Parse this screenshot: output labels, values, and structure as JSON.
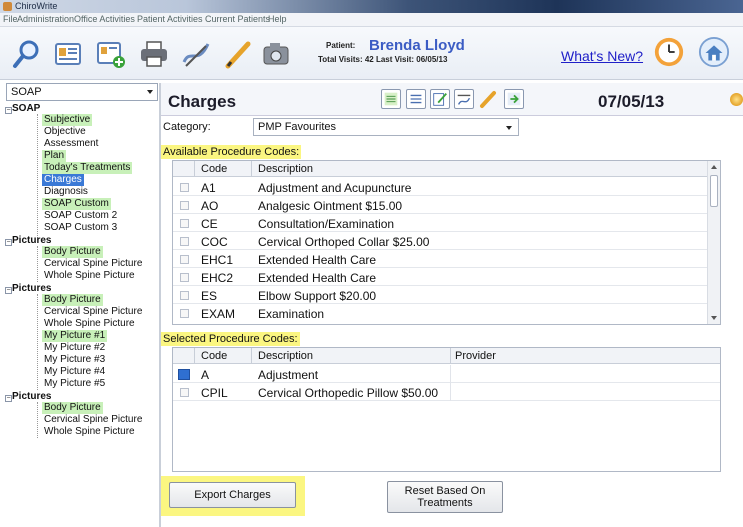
{
  "window": {
    "title": "ChiroWrite"
  },
  "menu": [
    "File",
    "Administration",
    "Office Activities",
    "Patient Activities",
    "Current Patients",
    "Help"
  ],
  "toolbar": {
    "icons": [
      "magnifier-icon",
      "card-icon",
      "add-card-icon",
      "printer-icon",
      "ruler-pencil-icon",
      "pencil-icon",
      "camera-icon"
    ],
    "patient_label": "Patient:",
    "patient_name": "Brenda Lloyd",
    "visits_text": "Total Visits: 42   Last Visit: 06/05/13",
    "whats_new": "What's New?"
  },
  "sidebar": {
    "dropdown_value": "SOAP",
    "groups": [
      {
        "label": "SOAP",
        "items": [
          {
            "label": "Subjective",
            "state": "highlight"
          },
          {
            "label": "Objective",
            "state": "normal"
          },
          {
            "label": "Assessment",
            "state": "normal"
          },
          {
            "label": "Plan",
            "state": "highlight"
          },
          {
            "label": "Today's Treatments",
            "state": "highlight"
          },
          {
            "label": "Charges",
            "state": "selected"
          },
          {
            "label": "Diagnosis",
            "state": "normal"
          },
          {
            "label": "SOAP Custom",
            "state": "highlight"
          },
          {
            "label": "SOAP Custom 2",
            "state": "normal"
          },
          {
            "label": "SOAP Custom 3",
            "state": "normal"
          }
        ]
      },
      {
        "label": "Pictures",
        "items": [
          {
            "label": "Body Picture",
            "state": "highlight"
          },
          {
            "label": "Cervical Spine Picture",
            "state": "normal"
          },
          {
            "label": "Whole Spine Picture",
            "state": "normal"
          }
        ]
      },
      {
        "label": "Pictures",
        "items": [
          {
            "label": "Body Picture",
            "state": "highlight"
          },
          {
            "label": "Cervical Spine Picture",
            "state": "normal"
          },
          {
            "label": "Whole Spine Picture",
            "state": "normal"
          },
          {
            "label": "My Picture #1",
            "state": "highlight"
          },
          {
            "label": "My Picture #2",
            "state": "normal"
          },
          {
            "label": "My Picture #3",
            "state": "normal"
          },
          {
            "label": "My Picture #4",
            "state": "normal"
          },
          {
            "label": "My Picture #5",
            "state": "normal"
          }
        ]
      },
      {
        "label": "Pictures",
        "items": [
          {
            "label": "Body Picture",
            "state": "highlight"
          },
          {
            "label": "Cervical Spine Picture",
            "state": "normal"
          },
          {
            "label": "Whole Spine Picture",
            "state": "normal"
          }
        ]
      }
    ]
  },
  "main": {
    "title": "Charges",
    "date": "07/05/13",
    "header_icons": [
      "list-green-icon",
      "list-icon",
      "edit-icon",
      "ruler-icon",
      "pencil-icon",
      "export-green-icon"
    ],
    "category_label": "Category:",
    "category_value": "PMP Favourites",
    "available_label": "Available Procedure Codes:",
    "available_columns": {
      "code": "Code",
      "description": "Description"
    },
    "available_rows": [
      {
        "code": "A1",
        "description": "Adjustment and Acupuncture"
      },
      {
        "code": "AO",
        "description": "Analgesic Ointment $15.00"
      },
      {
        "code": "CE",
        "description": "Consultation/Examination"
      },
      {
        "code": "COC",
        "description": "Cervical Orthoped Collar $25.00"
      },
      {
        "code": "EHC1",
        "description": "Extended Health Care"
      },
      {
        "code": "EHC2",
        "description": "Extended Health Care"
      },
      {
        "code": "ES",
        "description": "Elbow Support $20.00"
      },
      {
        "code": "EXAM",
        "description": "Examination"
      }
    ],
    "selected_label": "Selected Procedure Codes:",
    "selected_columns": {
      "code": "Code",
      "description": "Description",
      "provider": "Provider"
    },
    "selected_rows": [
      {
        "code": "A",
        "description": "Adjustment",
        "provider": "",
        "checked": true
      },
      {
        "code": "CPIL",
        "description": "Cervical Orthopedic Pillow $50.00",
        "provider": "",
        "checked": false
      }
    ],
    "export_button": "Export Charges",
    "reset_button": "Reset Based On Treatments"
  },
  "colors": {
    "highlight": "#fbf681",
    "tree_highlight": "#c8f0b9",
    "selected": "#3a79d6",
    "link": "#2020c8",
    "patient_name": "#3b5cc4"
  }
}
